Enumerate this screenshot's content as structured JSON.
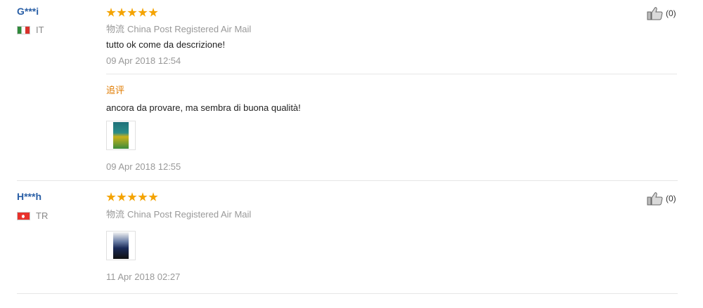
{
  "reviews": [
    {
      "user": "G***i",
      "country": "IT",
      "shipping_label": "物流",
      "shipping": "China Post Registered Air Mail",
      "text": "tutto ok come da descrizione!",
      "date": "09 Apr 2018 12:54",
      "helpful": "(0)",
      "stars": 5,
      "followup": {
        "label": "追评",
        "text": "ancora da provare, ma sembra di buona qualità!",
        "date": "09 Apr 2018 12:55"
      }
    },
    {
      "user": "H***h",
      "country": "TR",
      "shipping_label": "物流",
      "shipping": "China Post Registered Air Mail",
      "date": "11 Apr 2018 02:27",
      "helpful": "(0)",
      "stars": 5
    }
  ],
  "colors": {
    "star": "#f4a300",
    "username": "#2a5fa6",
    "followup": "#e07b00"
  },
  "icons": {
    "helpful": "thumbs-up-icon"
  }
}
